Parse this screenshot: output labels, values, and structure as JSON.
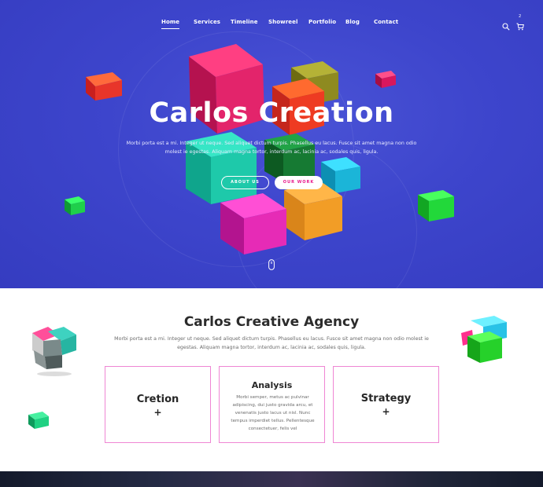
{
  "nav": {
    "items": [
      {
        "label": "Home",
        "active": true
      },
      {
        "label": "Services"
      },
      {
        "label": "Timeline"
      },
      {
        "label": "Showreel"
      },
      {
        "label": "Portfolio"
      },
      {
        "label": "Blog"
      },
      {
        "label": "Contact"
      }
    ],
    "cart_count": "2"
  },
  "hero": {
    "title": "Carlos Creation",
    "text": "Morbi porta est a mi. Integer ut neque. Sed aliquet dictum turpis. Phasellus eu lacus. Fusce sit amet magna non odio molest ie egestas. Aliquam magna tortor, interdum ac, lacinia ac, sodales quis, ligula.",
    "about_button": "ABOUT US",
    "work_button": "OUR WORK",
    "background_color": "#3d45cc"
  },
  "about": {
    "title": "Carlos Creative Agency",
    "text": "Morbi porta est a mi. Integer ut neque. Sed aliquet dictum turpis. Phasellus eu lacus. Fusce sit amet magna non odio molest ie egestas. Aliquam magna tortor, interdum ac, lacinia ac, sodales quis, ligula.",
    "cards": [
      {
        "title": "Cretion",
        "plus": "+"
      },
      {
        "title": "Analysis",
        "text": "Morbi semper, metus ac pulvinar adipiscing, dui justo gravida arcu, et venenatis justo lacus ut nisl. Nunc tempus imperdiet tellus. Pellentesque consectetuer, felis vel"
      },
      {
        "title": "Strategy",
        "plus": "+"
      }
    ],
    "card_border_color": "#ef86d4"
  }
}
